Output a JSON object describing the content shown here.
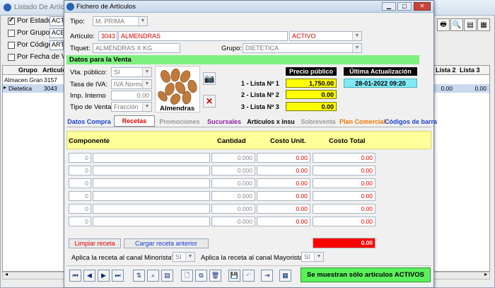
{
  "background": {
    "title": "Listado De Artículos",
    "filters": [
      {
        "label": "Por Estado",
        "checked": true,
        "value": "ACTI"
      },
      {
        "label": "Por Grupo",
        "checked": false,
        "value": "ACE"
      },
      {
        "label": "Por Código",
        "checked": false,
        "value": "ARTIC"
      },
      {
        "label": "Por Fecha de Vige",
        "checked": false,
        "value": ""
      }
    ],
    "columns": [
      "Grupo",
      "Articulo",
      "Lista 2",
      "Lista 3"
    ],
    "rows": [
      {
        "grupo": "Almacen Gran",
        "articulo": "3157",
        "l2": "",
        "l3": "",
        "selected": false
      },
      {
        "grupo": "Dietetica",
        "articulo": "3043",
        "l2": "0.00",
        "l3": "0.00",
        "selected": true
      }
    ]
  },
  "dialog": {
    "title": "Fichero de Artículos",
    "tipo_label": "Tipo:",
    "tipo_value": "M. PRIMA",
    "articulo_label": "Artículo:",
    "articulo_code": "3043",
    "articulo_name": "ALMENDRAS",
    "estado": "ACTIVO",
    "tiquet_label": "Tiquet:",
    "tiquet_value": "ALMENDRAS X KG",
    "grupo_label": "Grupo:",
    "grupo_value": "DIETETICA",
    "venta_section": "Datos para la Venta",
    "vta_publico_label": "Vta. público:",
    "vta_publico_value": "SI",
    "tasa_iva_label": "Tasa de IVA:",
    "tasa_iva_value": "IVA Normal",
    "imp_interno_label": "Imp. Interno",
    "imp_interno_value": "0.00",
    "tipo_venta_label": "Tipo de Venta:",
    "tipo_venta_value": "Fracción",
    "image_caption": "Almendras",
    "precio_publico_header": "Precio público",
    "ultima_act_header": "Última Actualización",
    "listas": [
      {
        "label": "1 - Lista Nº 1",
        "value": "1,750.00"
      },
      {
        "label": "2 - Lista Nº 2",
        "value": "0.00"
      },
      {
        "label": "3 - Lista Nº 3",
        "value": "0.00"
      }
    ],
    "ultima_act_value": "28-01-2022 09:20",
    "tabs": [
      {
        "label": "Datos Compra",
        "color": "#1a3fd0",
        "active": false
      },
      {
        "label": "Recetas",
        "color": "#e00000",
        "active": true
      },
      {
        "label": "Promociones",
        "color": "#9a9a9a",
        "active": false
      },
      {
        "label": "Sucursales",
        "color": "#8b1fa0",
        "active": false
      },
      {
        "label": "Artículos x insu",
        "color": "#000000",
        "active": false
      },
      {
        "label": "Sobreventa",
        "color": "#9a9a9a",
        "active": false
      },
      {
        "label": "Plan Comercial",
        "color": "#f07800",
        "active": false
      },
      {
        "label": "Códigos de barra",
        "color": "#1a3fd0",
        "active": false
      }
    ],
    "recipe_headers": {
      "componente": "Componente",
      "cantidad": "Cantidad",
      "costo_unit": "Costo Unit.",
      "costo_total": "Costo Total"
    },
    "recipe_rows": [
      {
        "code": "0",
        "name": "",
        "cantidad": "0.000",
        "costo_unit": "0.00",
        "costo_total": "0.00"
      },
      {
        "code": "0",
        "name": "",
        "cantidad": "0.000",
        "costo_unit": "0.00",
        "costo_total": "0.00"
      },
      {
        "code": "0",
        "name": "",
        "cantidad": "0.000",
        "costo_unit": "0.00",
        "costo_total": "0.00"
      },
      {
        "code": "0",
        "name": "",
        "cantidad": "0.000",
        "costo_unit": "0.00",
        "costo_total": "0.00"
      },
      {
        "code": "0",
        "name": "",
        "cantidad": "0.000",
        "costo_unit": "0.00",
        "costo_total": "0.00"
      },
      {
        "code": "0",
        "name": "",
        "cantidad": "0.000",
        "costo_unit": "0.00",
        "costo_total": "0.00"
      }
    ],
    "limpiar_label": "Limpiar receta",
    "cargar_label": "Cargar receta anterior",
    "total_value": "0.00",
    "minorista_label": "Aplica la receta al canal Minorista?",
    "minorista_value": "SI",
    "mayorista_label": "Aplica la receta al canal Mayorista?",
    "mayorista_value": "SI",
    "status_message": "Se muestran sólo artículos ACTIVOS"
  }
}
